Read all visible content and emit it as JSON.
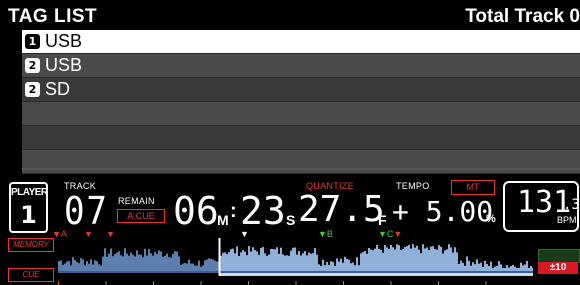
{
  "tag_list": {
    "title": "TAG LIST",
    "total_label": "Total Track 0",
    "rows": [
      {
        "badge": "1",
        "label": "USB",
        "selected": true
      },
      {
        "badge": "2",
        "label": "USB",
        "selected": false
      },
      {
        "badge": "2",
        "label": "SD",
        "selected": false
      },
      {
        "badge": "",
        "label": "",
        "selected": false
      },
      {
        "badge": "",
        "label": "",
        "selected": false
      },
      {
        "badge": "",
        "label": "",
        "selected": false
      }
    ]
  },
  "deck": {
    "player_label": "PLAYER",
    "player_number": "1",
    "track_label": "TRACK",
    "track_number": "07",
    "remain_label": "REMAIN",
    "acue_label": "A.CUE",
    "time_minutes": "06",
    "time_m_unit": "M",
    "time_seconds": "23",
    "time_s_unit": "S",
    "time_frames": "27.5",
    "time_f_unit": "F",
    "quantize_label": "QUANTIZE",
    "tempo_label": "TEMPO",
    "mt_label": "MT",
    "tempo_value": "+ 5.00",
    "tempo_unit": "%",
    "bpm_value": "131",
    "bpm_decimal": ".3",
    "bpm_unit": "BPM"
  },
  "waveform": {
    "memory_label": "MEMORY",
    "cue_label": "CUE",
    "markers": [
      "A",
      "B",
      "C"
    ],
    "pitch_badge": "±10",
    "played_fraction": 0.34,
    "colors": {
      "wave": "#8fb0d8",
      "wave_dark": "#5d7fae",
      "red": "#e8382c",
      "green": "#42c93c",
      "white": "#ffffff"
    }
  }
}
